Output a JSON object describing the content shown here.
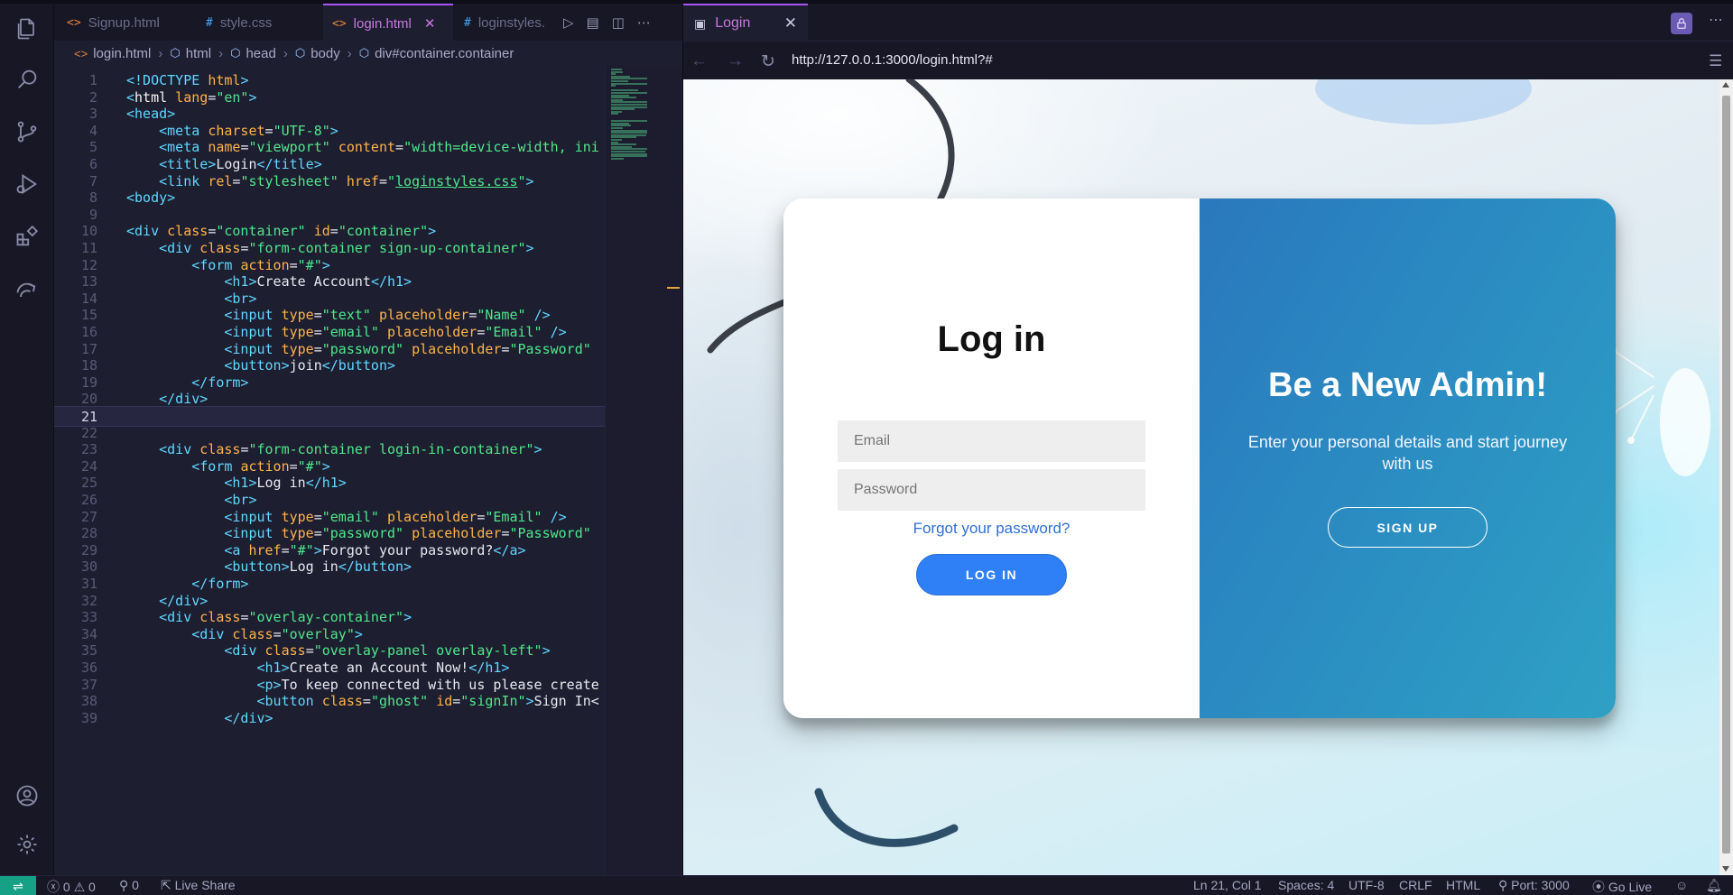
{
  "editor": {
    "tabs": [
      {
        "icon": "<>",
        "label": "Signup.html"
      },
      {
        "icon": "#",
        "label": "style.css"
      },
      {
        "icon": "<>",
        "label": "login.html",
        "active": true
      },
      {
        "icon": "#",
        "label": "loginstyles."
      }
    ],
    "tab_close": "✕",
    "breadcrumb": [
      "login.html",
      "html",
      "head",
      "body",
      "div#container.container"
    ],
    "current_line": 21,
    "lines": [
      {
        "n": "1",
        "segs": [
          [
            "t",
            "<!DOCTYPE "
          ],
          [
            "a",
            "html"
          ],
          [
            "t",
            ">"
          ]
        ]
      },
      {
        "n": "2",
        "segs": [
          [
            "t",
            "<"
          ],
          [
            "n",
            "html "
          ],
          [
            "a",
            "lang"
          ],
          [
            "x",
            "="
          ],
          [
            "s",
            "\"en\""
          ],
          [
            "t",
            ">"
          ]
        ]
      },
      {
        "n": "3",
        "segs": [
          [
            "t",
            "<head>"
          ]
        ]
      },
      {
        "n": "4",
        "segs": [
          [
            "x",
            "    "
          ],
          [
            "t",
            "<meta "
          ],
          [
            "a",
            "charset"
          ],
          [
            "x",
            "="
          ],
          [
            "s",
            "\"UTF-8\""
          ],
          [
            "t",
            ">"
          ]
        ]
      },
      {
        "n": "5",
        "segs": [
          [
            "x",
            "    "
          ],
          [
            "t",
            "<meta "
          ],
          [
            "a",
            "name"
          ],
          [
            "x",
            "="
          ],
          [
            "s",
            "\"viewport\" "
          ],
          [
            "a",
            "content"
          ],
          [
            "x",
            "="
          ],
          [
            "s",
            "\"width=device-width, ini"
          ]
        ]
      },
      {
        "n": "6",
        "segs": [
          [
            "x",
            "    "
          ],
          [
            "t",
            "<title>"
          ],
          [
            "x",
            "Login"
          ],
          [
            "t",
            "</title>"
          ]
        ]
      },
      {
        "n": "7",
        "segs": [
          [
            "x",
            "    "
          ],
          [
            "t",
            "<link "
          ],
          [
            "a",
            "rel"
          ],
          [
            "x",
            "="
          ],
          [
            "s",
            "\"stylesheet\" "
          ],
          [
            "a",
            "href"
          ],
          [
            "x",
            "="
          ],
          [
            "s",
            "\""
          ],
          [
            "su",
            "loginstyles.css"
          ],
          [
            "s",
            "\""
          ],
          [
            "t",
            ">"
          ]
        ]
      },
      {
        "n": "8",
        "segs": [
          [
            "t",
            "<body>"
          ]
        ]
      },
      {
        "n": "9",
        "segs": []
      },
      {
        "n": "10",
        "segs": [
          [
            "t",
            "<div "
          ],
          [
            "a",
            "class"
          ],
          [
            "x",
            "="
          ],
          [
            "s",
            "\"container\" "
          ],
          [
            "a",
            "id"
          ],
          [
            "x",
            "="
          ],
          [
            "s",
            "\"container\""
          ],
          [
            "t",
            ">"
          ]
        ]
      },
      {
        "n": "11",
        "segs": [
          [
            "x",
            "    "
          ],
          [
            "t",
            "<div "
          ],
          [
            "a",
            "class"
          ],
          [
            "x",
            "="
          ],
          [
            "s",
            "\"form-container sign-up-container\""
          ],
          [
            "t",
            ">"
          ]
        ]
      },
      {
        "n": "12",
        "segs": [
          [
            "x",
            "        "
          ],
          [
            "t",
            "<form "
          ],
          [
            "a",
            "action"
          ],
          [
            "x",
            "="
          ],
          [
            "s",
            "\"#\""
          ],
          [
            "t",
            ">"
          ]
        ]
      },
      {
        "n": "13",
        "segs": [
          [
            "x",
            "            "
          ],
          [
            "t",
            "<h1>"
          ],
          [
            "x",
            "Create Account"
          ],
          [
            "t",
            "</h1>"
          ]
        ]
      },
      {
        "n": "14",
        "segs": [
          [
            "x",
            "            "
          ],
          [
            "t",
            "<br>"
          ]
        ]
      },
      {
        "n": "15",
        "segs": [
          [
            "x",
            "            "
          ],
          [
            "t",
            "<input "
          ],
          [
            "a",
            "type"
          ],
          [
            "x",
            "="
          ],
          [
            "s",
            "\"text\" "
          ],
          [
            "a",
            "placeholder"
          ],
          [
            "x",
            "="
          ],
          [
            "s",
            "\"Name\" "
          ],
          [
            "t",
            "/>"
          ]
        ]
      },
      {
        "n": "16",
        "segs": [
          [
            "x",
            "            "
          ],
          [
            "t",
            "<input "
          ],
          [
            "a",
            "type"
          ],
          [
            "x",
            "="
          ],
          [
            "s",
            "\"email\" "
          ],
          [
            "a",
            "placeholder"
          ],
          [
            "x",
            "="
          ],
          [
            "s",
            "\"Email\" "
          ],
          [
            "t",
            "/>"
          ]
        ]
      },
      {
        "n": "17",
        "segs": [
          [
            "x",
            "            "
          ],
          [
            "t",
            "<input "
          ],
          [
            "a",
            "type"
          ],
          [
            "x",
            "="
          ],
          [
            "s",
            "\"password\" "
          ],
          [
            "a",
            "placeholder"
          ],
          [
            "x",
            "="
          ],
          [
            "s",
            "\"Password\""
          ]
        ]
      },
      {
        "n": "18",
        "segs": [
          [
            "x",
            "            "
          ],
          [
            "t",
            "<button>"
          ],
          [
            "x",
            "join"
          ],
          [
            "t",
            "</button>"
          ]
        ]
      },
      {
        "n": "19",
        "segs": [
          [
            "x",
            "        "
          ],
          [
            "t",
            "</form>"
          ]
        ]
      },
      {
        "n": "20",
        "segs": [
          [
            "x",
            "    "
          ],
          [
            "t",
            "</div>"
          ]
        ]
      },
      {
        "n": "21",
        "segs": []
      },
      {
        "n": "22",
        "segs": []
      },
      {
        "n": "23",
        "segs": [
          [
            "x",
            "    "
          ],
          [
            "t",
            "<div "
          ],
          [
            "a",
            "class"
          ],
          [
            "x",
            "="
          ],
          [
            "s",
            "\"form-container login-in-container\""
          ],
          [
            "t",
            ">"
          ]
        ]
      },
      {
        "n": "24",
        "segs": [
          [
            "x",
            "        "
          ],
          [
            "t",
            "<form "
          ],
          [
            "a",
            "action"
          ],
          [
            "x",
            "="
          ],
          [
            "s",
            "\"#\""
          ],
          [
            "t",
            ">"
          ]
        ]
      },
      {
        "n": "25",
        "segs": [
          [
            "x",
            "            "
          ],
          [
            "t",
            "<h1>"
          ],
          [
            "x",
            "Log in"
          ],
          [
            "t",
            "</h1>"
          ]
        ]
      },
      {
        "n": "26",
        "segs": [
          [
            "x",
            "            "
          ],
          [
            "t",
            "<br>"
          ]
        ]
      },
      {
        "n": "27",
        "segs": [
          [
            "x",
            "            "
          ],
          [
            "t",
            "<input "
          ],
          [
            "a",
            "type"
          ],
          [
            "x",
            "="
          ],
          [
            "s",
            "\"email\" "
          ],
          [
            "a",
            "placeholder"
          ],
          [
            "x",
            "="
          ],
          [
            "s",
            "\"Email\" "
          ],
          [
            "t",
            "/>"
          ]
        ]
      },
      {
        "n": "28",
        "segs": [
          [
            "x",
            "            "
          ],
          [
            "t",
            "<input "
          ],
          [
            "a",
            "type"
          ],
          [
            "x",
            "="
          ],
          [
            "s",
            "\"password\" "
          ],
          [
            "a",
            "placeholder"
          ],
          [
            "x",
            "="
          ],
          [
            "s",
            "\"Password\""
          ]
        ]
      },
      {
        "n": "29",
        "segs": [
          [
            "x",
            "            "
          ],
          [
            "t",
            "<a "
          ],
          [
            "a",
            "href"
          ],
          [
            "x",
            "="
          ],
          [
            "s",
            "\"#\""
          ],
          [
            "t",
            ">"
          ],
          [
            "x",
            "Forgot your password?"
          ],
          [
            "t",
            "</a>"
          ]
        ]
      },
      {
        "n": "30",
        "segs": [
          [
            "x",
            "            "
          ],
          [
            "t",
            "<button>"
          ],
          [
            "x",
            "Log in"
          ],
          [
            "t",
            "</button>"
          ]
        ]
      },
      {
        "n": "31",
        "segs": [
          [
            "x",
            "        "
          ],
          [
            "t",
            "</form>"
          ]
        ]
      },
      {
        "n": "32",
        "segs": [
          [
            "x",
            "    "
          ],
          [
            "t",
            "</div>"
          ]
        ]
      },
      {
        "n": "33",
        "segs": [
          [
            "x",
            "    "
          ],
          [
            "t",
            "<div "
          ],
          [
            "a",
            "class"
          ],
          [
            "x",
            "="
          ],
          [
            "s",
            "\"overlay-container\""
          ],
          [
            "t",
            ">"
          ]
        ]
      },
      {
        "n": "34",
        "segs": [
          [
            "x",
            "        "
          ],
          [
            "t",
            "<div "
          ],
          [
            "a",
            "class"
          ],
          [
            "x",
            "="
          ],
          [
            "s",
            "\"overlay\""
          ],
          [
            "t",
            ">"
          ]
        ]
      },
      {
        "n": "35",
        "segs": [
          [
            "x",
            "            "
          ],
          [
            "t",
            "<div "
          ],
          [
            "a",
            "class"
          ],
          [
            "x",
            "="
          ],
          [
            "s",
            "\"overlay-panel overlay-left\""
          ],
          [
            "t",
            ">"
          ]
        ]
      },
      {
        "n": "36",
        "segs": [
          [
            "x",
            "                "
          ],
          [
            "t",
            "<h1>"
          ],
          [
            "x",
            "Create an Account Now!"
          ],
          [
            "t",
            "</h1>"
          ]
        ]
      },
      {
        "n": "37",
        "segs": [
          [
            "x",
            "                "
          ],
          [
            "t",
            "<p>"
          ],
          [
            "x",
            "To keep connected with us please create"
          ]
        ]
      },
      {
        "n": "38",
        "segs": [
          [
            "x",
            "                "
          ],
          [
            "t",
            "<button "
          ],
          [
            "a",
            "class"
          ],
          [
            "x",
            "="
          ],
          [
            "s",
            "\"ghost\" "
          ],
          [
            "a",
            "id"
          ],
          [
            "x",
            "="
          ],
          [
            "s",
            "\"signIn\""
          ],
          [
            "t",
            ">"
          ],
          [
            "x",
            "Sign In<"
          ]
        ]
      },
      {
        "n": "39",
        "segs": [
          [
            "x",
            "            "
          ],
          [
            "t",
            "</div>"
          ]
        ]
      }
    ]
  },
  "preview": {
    "tab_label": "Login",
    "tab_close": "✕",
    "url": "http://127.0.0.1:3000/login.html?#",
    "page": {
      "login_title": "Log in",
      "email_placeholder": "Email",
      "password_placeholder": "Password",
      "forgot_link": "Forgot your password?",
      "login_button": "LOG IN",
      "admin_title": "Be a New Admin!",
      "admin_text": "Enter your personal details and start journey with us",
      "signup_button": "SIGN UP"
    }
  },
  "statusbar": {
    "errors": "0",
    "warnings": "0",
    "ports": "0",
    "live_share": "Live Share",
    "position": "Ln 21, Col 1",
    "spaces": "Spaces: 4",
    "encoding": "UTF-8",
    "eol": "CRLF",
    "language": "HTML",
    "port": "Port: 3000",
    "go_live": "Go Live"
  },
  "colors": {
    "accent": "#a855f7",
    "login_button": "#2f7ff7",
    "admin_panel": "#2b8fc2",
    "remote_indicator": "#16a085"
  }
}
